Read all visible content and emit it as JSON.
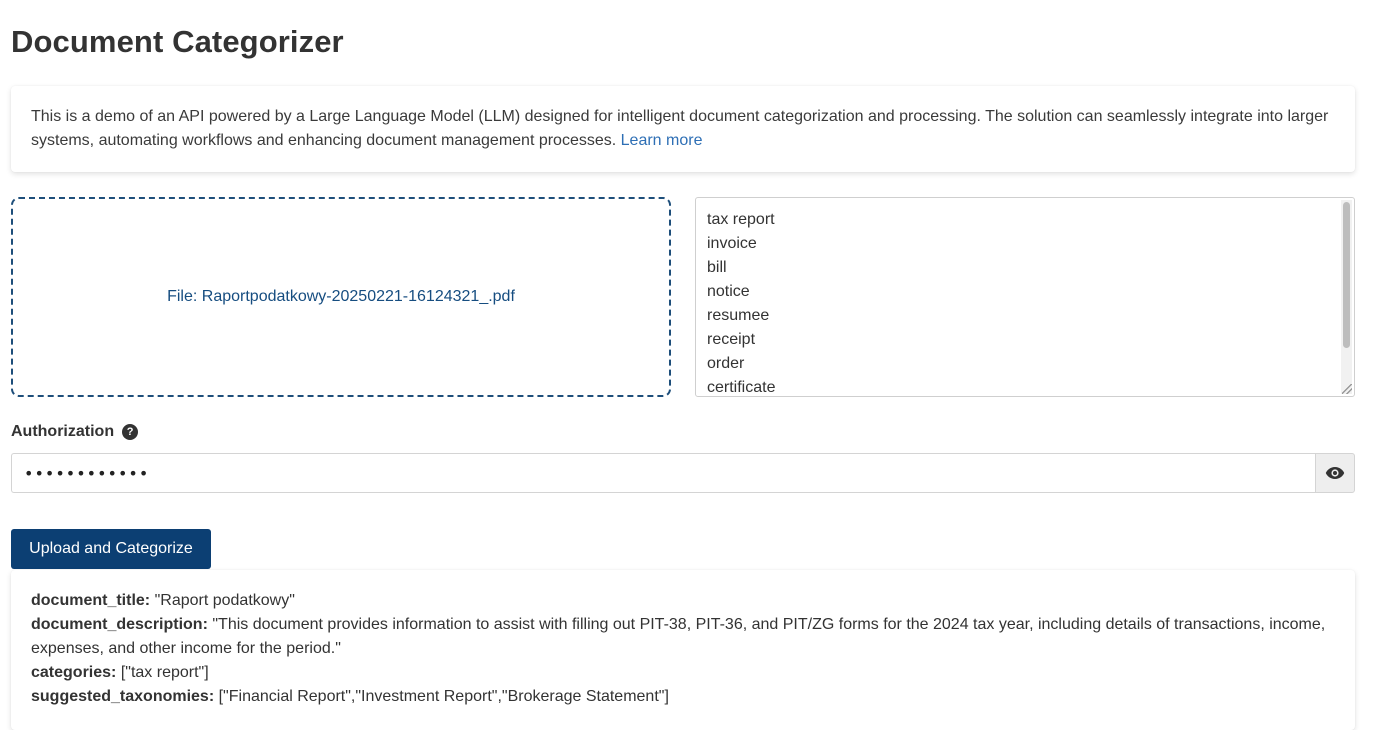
{
  "page": {
    "title": "Document Categorizer"
  },
  "intro": {
    "text": "This is a demo of an API powered by a Large Language Model (LLM) designed for intelligent document categorization and processing. The solution can seamlessly integrate into larger systems, automating workflows and enhancing document management processes.",
    "link_label": "Learn more"
  },
  "upload": {
    "file_label": "File: Raportpodatkowy-20250221-16124321_.pdf"
  },
  "categories": {
    "items": [
      "tax report",
      "invoice",
      "bill",
      "notice",
      "resumee",
      "receipt",
      "order",
      "certificate"
    ]
  },
  "auth": {
    "label": "Authorization",
    "help_icon": "question-circle-icon",
    "value": "••••••••••••",
    "toggle_icon": "eye-icon"
  },
  "actions": {
    "submit_label": "Upload and Categorize"
  },
  "result": {
    "fields": [
      {
        "key": "document_title:",
        "value": "\"Raport podatkowy\""
      },
      {
        "key": "document_description:",
        "value": "\"This document provides information to assist with filling out PIT-38, PIT-36, and PIT/ZG forms for the 2024 tax year, including details of transactions, income, expenses, and other income for the period.\""
      },
      {
        "key": "categories:",
        "value": "[\"tax report\"]"
      },
      {
        "key": "suggested_taxonomies:",
        "value": "[\"Financial Report\",\"Investment Report\",\"Brokerage Statement\"]"
      }
    ]
  },
  "colors": {
    "primary": "#0c3f73",
    "link": "#2e6fb5",
    "dropzone_border": "#1d4e7a"
  }
}
